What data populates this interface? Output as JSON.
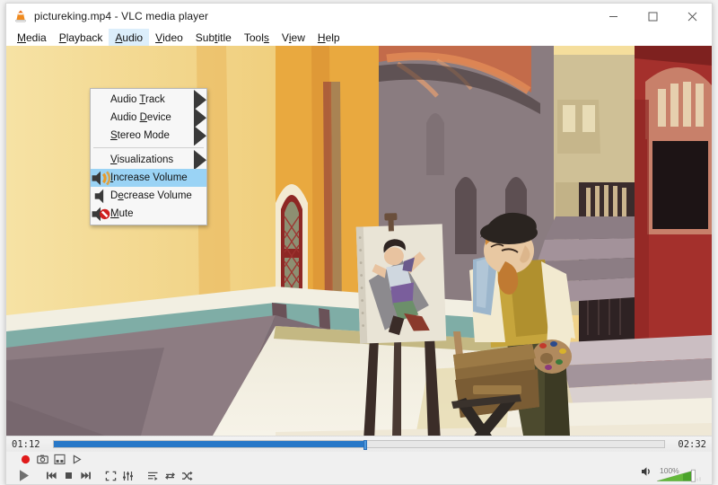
{
  "window": {
    "title": "pictureking.mp4 - VLC media player",
    "app_icon": "vlc-cone-icon",
    "controls": {
      "minimize": "minimize-icon",
      "maximize": "maximize-icon",
      "close": "close-icon"
    }
  },
  "menubar": {
    "items": [
      {
        "label": "Media",
        "mnemonic": "M",
        "active": false
      },
      {
        "label": "Playback",
        "mnemonic": "P",
        "active": false
      },
      {
        "label": "Audio",
        "mnemonic": "A",
        "active": true
      },
      {
        "label": "Video",
        "mnemonic": "V",
        "active": false
      },
      {
        "label": "Subtitle",
        "mnemonic": "t",
        "active": false
      },
      {
        "label": "Tools",
        "mnemonic": "s",
        "active": false
      },
      {
        "label": "View",
        "mnemonic": "i",
        "active": false
      },
      {
        "label": "Help",
        "mnemonic": "H",
        "active": false
      }
    ]
  },
  "dropdown": {
    "owner": "Audio",
    "items": [
      {
        "label": "Audio Track",
        "mnemonic": "T",
        "submenu": true,
        "selected": false,
        "icon": null,
        "separator_before": false
      },
      {
        "label": "Audio Device",
        "mnemonic": "D",
        "submenu": true,
        "selected": false,
        "icon": null,
        "separator_before": false
      },
      {
        "label": "Stereo Mode",
        "mnemonic": "S",
        "submenu": true,
        "selected": false,
        "icon": null,
        "separator_before": false
      },
      {
        "label": "Visualizations",
        "mnemonic": "V",
        "submenu": true,
        "selected": false,
        "icon": null,
        "separator_before": true
      },
      {
        "label": "Increase Volume",
        "mnemonic": "I",
        "submenu": false,
        "selected": true,
        "icon": "volume-up-icon",
        "separator_before": false
      },
      {
        "label": "Decrease Volume",
        "mnemonic": "e",
        "submenu": false,
        "selected": false,
        "icon": "volume-down-icon",
        "separator_before": false
      },
      {
        "label": "Mute",
        "mnemonic": "M",
        "submenu": false,
        "selected": false,
        "icon": "mute-icon",
        "separator_before": false
      }
    ],
    "highlight_color": "#9ad3f5"
  },
  "player": {
    "elapsed": "01:12",
    "total": "02:32",
    "progress_percent": 51,
    "seek_fill_color": "#2878c8",
    "volume_percent": "100%",
    "volume_color": "#4aa32a",
    "controls_row1": [
      {
        "name": "record-button",
        "icon": "record-icon"
      },
      {
        "name": "snapshot-button",
        "icon": "camera-icon"
      },
      {
        "name": "frame-by-frame-button",
        "icon": "frame-icon"
      },
      {
        "name": "advanced-play-button",
        "icon": "play-small-icon"
      }
    ],
    "controls_row2": [
      {
        "name": "play-pause-button",
        "icon": "play-icon"
      },
      {
        "name": "previous-button",
        "icon": "previous-icon"
      },
      {
        "name": "stop-button",
        "icon": "stop-icon"
      },
      {
        "name": "next-button",
        "icon": "next-icon"
      },
      {
        "name": "fullscreen-button",
        "icon": "fullscreen-icon"
      },
      {
        "name": "equalizer-button",
        "icon": "equalizer-icon"
      },
      {
        "name": "playlist-button",
        "icon": "playlist-icon"
      },
      {
        "name": "loop-button",
        "icon": "loop-icon"
      },
      {
        "name": "shuffle-button",
        "icon": "shuffle-icon"
      }
    ]
  },
  "video": {
    "scene": "illustrated-street-painter-scene",
    "palette": {
      "wall_yellow": "#f2d488",
      "wall_orange": "#e8a94b",
      "building_gray": "#8b7d80",
      "building_red": "#a8302c",
      "teal_rail": "#7fada6",
      "pavement": "#ece7d5",
      "shadow_mauve": "#8d7c82"
    }
  }
}
